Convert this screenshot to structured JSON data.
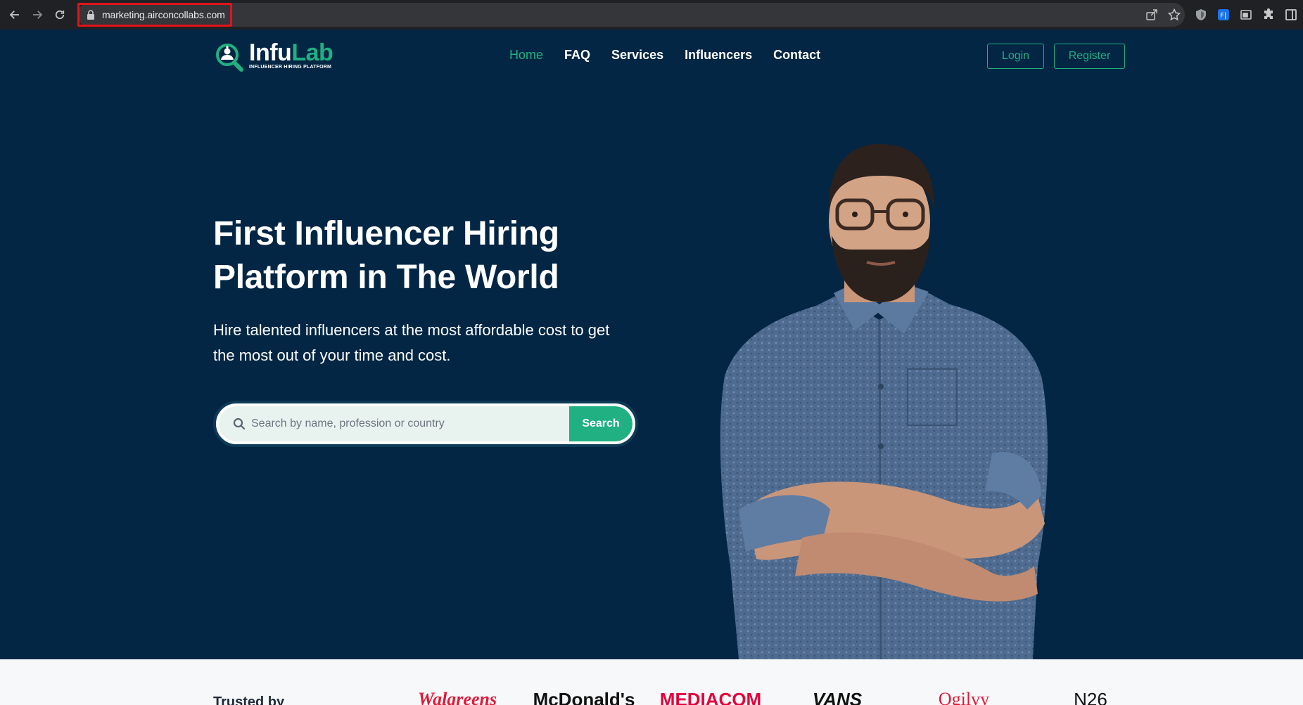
{
  "browser": {
    "url": "marketing.airconcollabs.com",
    "icons": [
      "back-arrow-icon",
      "forward-arrow-icon",
      "reload-icon",
      "lock-icon",
      "share-icon",
      "star-icon",
      "shield-extension-icon",
      "translate-extension-icon",
      "tab-extension-icon",
      "puzzle-icon",
      "side-panel-icon"
    ]
  },
  "logo": {
    "name_part1": "Infu",
    "name_part2": "Lab",
    "tagline": "INFLUENCER HIRING PLATFORM"
  },
  "nav": {
    "items": [
      {
        "label": "Home",
        "active": true
      },
      {
        "label": "FAQ",
        "active": false
      },
      {
        "label": "Services",
        "active": false
      },
      {
        "label": "Influencers",
        "active": false
      },
      {
        "label": "Contact",
        "active": false
      }
    ]
  },
  "auth": {
    "login": "Login",
    "register": "Register"
  },
  "hero": {
    "title_line1": "First Influencer Hiring",
    "title_line2": "Platform in The World",
    "subtitle_line1": "Hire talented influencers at the most affordable cost to get",
    "subtitle_line2": "the most out of your time and cost."
  },
  "search": {
    "placeholder": "Search by name, profession or country",
    "button": "Search"
  },
  "trusted": {
    "label": "Trusted by",
    "brands": [
      "Walgreens",
      "McDonald's",
      "MEDIACOM",
      "VANS",
      "Ogilvy",
      "N26"
    ]
  },
  "colors": {
    "page_bg": "#022644",
    "accent": "#20b081",
    "chrome_bg": "#202124"
  }
}
